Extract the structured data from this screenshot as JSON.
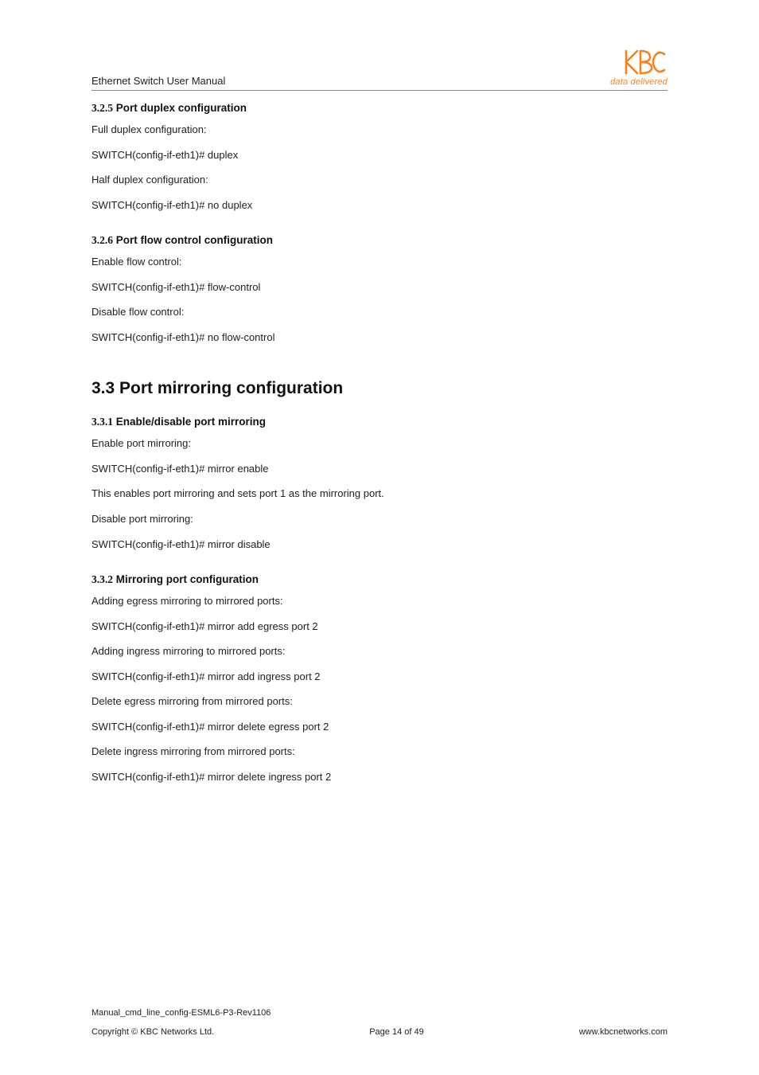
{
  "header": {
    "title": "Ethernet Switch User Manual",
    "tagline": "data delivered"
  },
  "s325": {
    "num": "3.2.5",
    "title": "Port duplex configuration",
    "l1": "Full duplex configuration:",
    "l2": "SWITCH(config-if-eth1)# duplex",
    "l3": "Half duplex configuration:",
    "l4": "SWITCH(config-if-eth1)# no duplex"
  },
  "s326": {
    "num": "3.2.6",
    "title": "Port flow control configuration",
    "l1": "Enable flow control:",
    "l2": "SWITCH(config-if-eth1)# flow-control",
    "l3": "Disable flow control:",
    "l4": "SWITCH(config-if-eth1)# no flow-control"
  },
  "h33": "3.3 Port mirroring configuration",
  "s331": {
    "num": "3.3.1",
    "title": "Enable/disable port mirroring",
    "l1": "Enable port mirroring:",
    "l2": "SWITCH(config-if-eth1)# mirror enable",
    "l3": "This enables port mirroring and sets port 1 as the mirroring port.",
    "l4": "Disable port mirroring:",
    "l5": "SWITCH(config-if-eth1)# mirror disable"
  },
  "s332": {
    "num": "3.3.2",
    "title": "Mirroring port configuration",
    "l1": "Adding egress mirroring to mirrored ports:",
    "l2": "SWITCH(config-if-eth1)# mirror add egress port 2",
    "l3": "Adding ingress mirroring to mirrored ports:",
    "l4": "SWITCH(config-if-eth1)# mirror add ingress port 2",
    "l5": "Delete egress mirroring from mirrored ports:",
    "l6": "SWITCH(config-if-eth1)# mirror delete egress port 2",
    "l7": "Delete ingress mirroring from mirrored ports:",
    "l8": "SWITCH(config-if-eth1)# mirror delete ingress port 2"
  },
  "footer": {
    "file": "Manual_cmd_line_config-ESML6-P3-Rev1106",
    "copyright": "Copyright © KBC Networks Ltd.",
    "page": "Page 14 of 49",
    "url": "www.kbcnetworks.com"
  }
}
